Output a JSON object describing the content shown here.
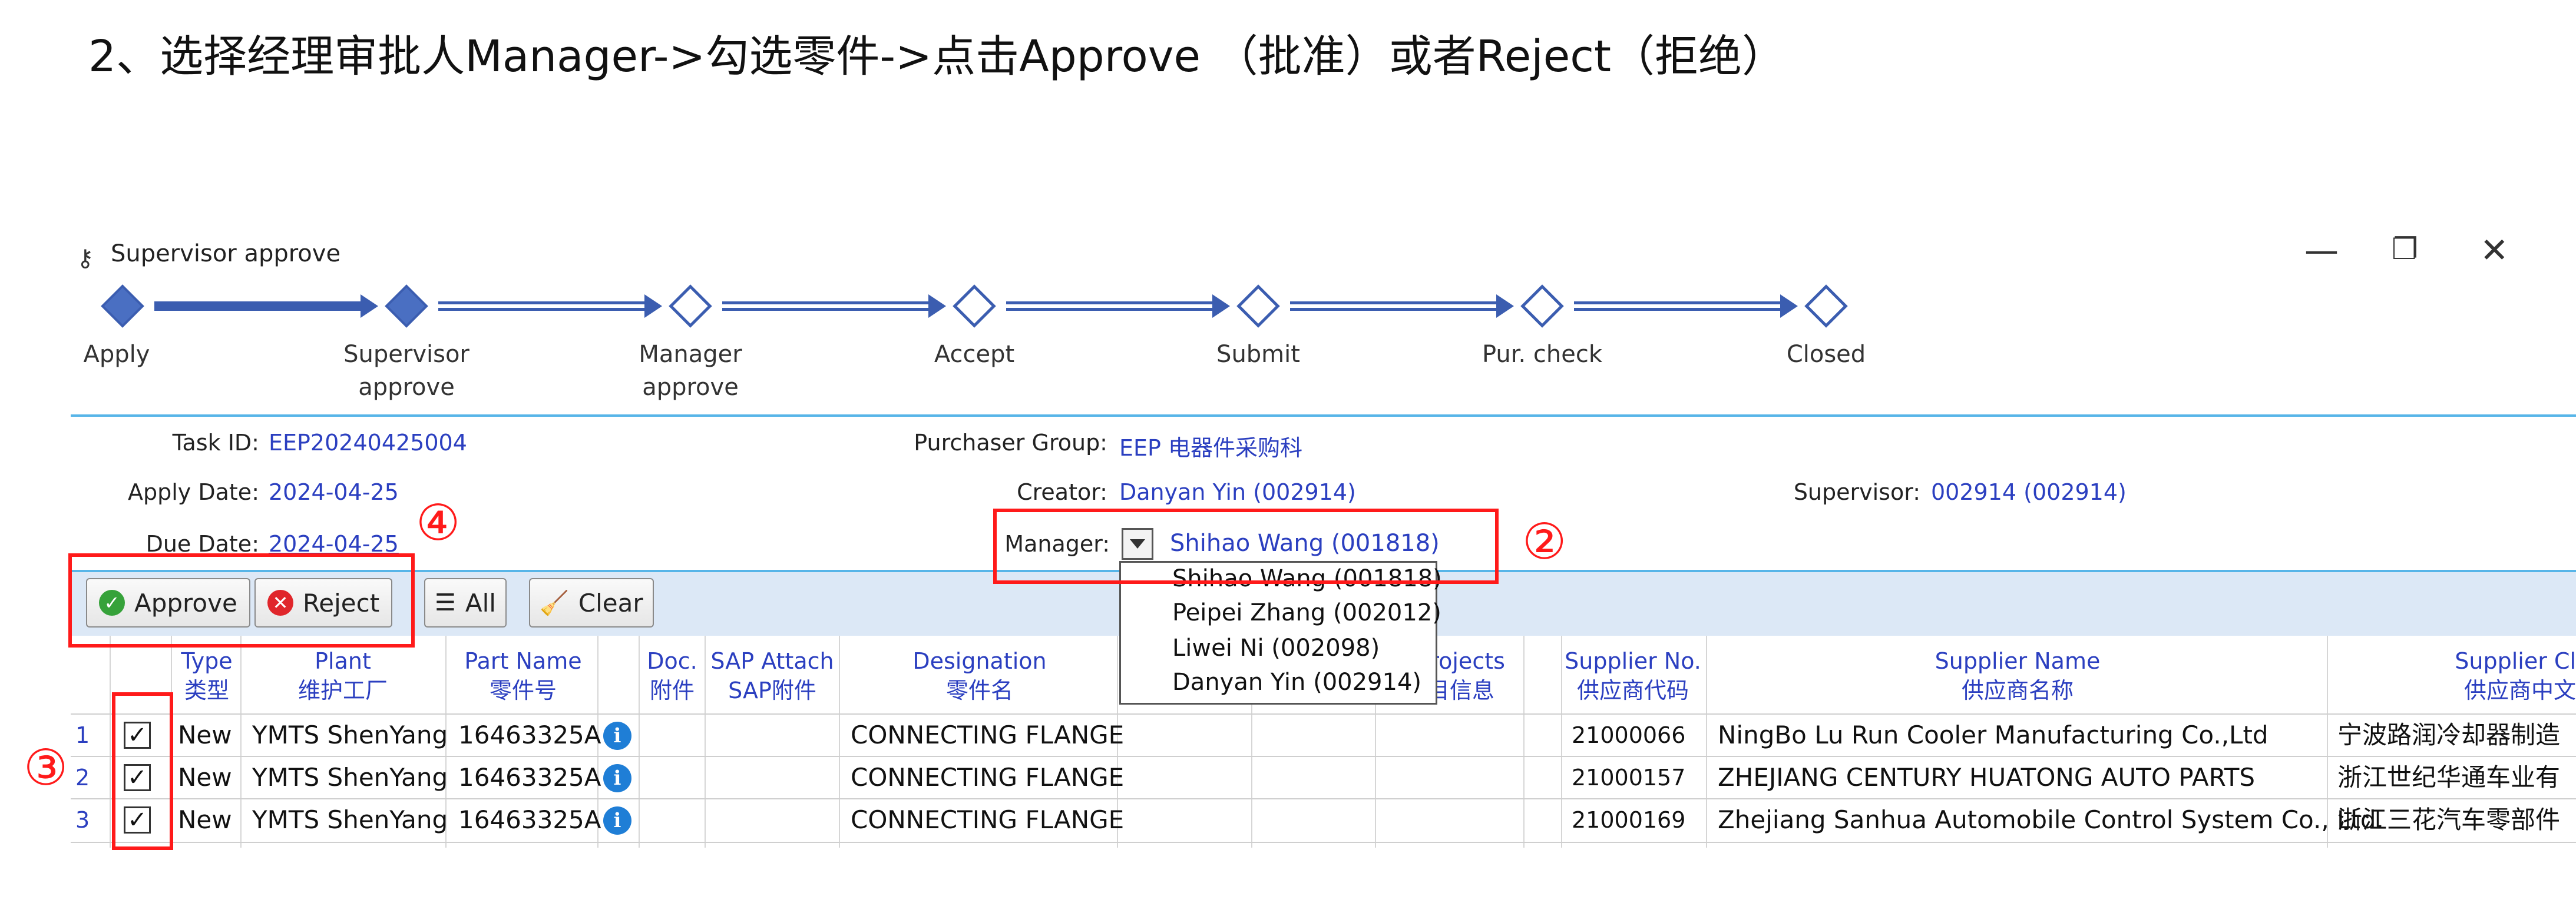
{
  "heading": "2、选择经理审批人Manager->勾选零件->点击Approve （批准）或者Reject（拒绝）",
  "window": {
    "title": "Supervisor approve",
    "controls": {
      "minimize": "—",
      "restore": "❐",
      "close": "✕"
    }
  },
  "workflow": {
    "steps": [
      {
        "label1": "Apply",
        "label2": "",
        "status": "done"
      },
      {
        "label1": "Supervisor",
        "label2": "approve",
        "status": "done"
      },
      {
        "label1": "Manager",
        "label2": "approve",
        "status": "todo"
      },
      {
        "label1": "Accept",
        "label2": "",
        "status": "todo"
      },
      {
        "label1": "Submit",
        "label2": "",
        "status": "todo"
      },
      {
        "label1": "Pur. check",
        "label2": "",
        "status": "todo"
      },
      {
        "label1": "Closed",
        "label2": "",
        "status": "todo"
      }
    ]
  },
  "info": {
    "task_id_label": "Task ID:",
    "task_id": "EEP20240425004",
    "purchaser_group_label": "Purchaser Group:",
    "purchaser_group": "EEP 电器件采购科",
    "apply_date_label": "Apply Date:",
    "apply_date": "2024-04-25",
    "creator_label": "Creator:",
    "creator": "Danyan Yin (002914)",
    "supervisor_label": "Supervisor:",
    "supervisor": "002914 (002914)",
    "due_date_label": "Due Date:",
    "due_date": "2024-04-25",
    "manager_label": "Manager:",
    "manager_selected": "Shihao Wang (001818)"
  },
  "manager_dropdown": {
    "options": [
      "Shihao Wang (001818)",
      "Peipei Zhang (002012)",
      "Liwei Ni (002098)",
      "Danyan Yin (002914)"
    ]
  },
  "toolbar": {
    "approve_label": "Approve",
    "reject_label": "Reject",
    "all_label": "All",
    "clear_label": "Clear"
  },
  "table": {
    "headers": {
      "type": [
        "Type",
        "类型"
      ],
      "plant": [
        "Plant",
        "维护工厂"
      ],
      "part_name": [
        "Part Name",
        "零件号"
      ],
      "doc": [
        "Doc.",
        "附件"
      ],
      "sap": [
        "SAP Attach",
        "SAP附件"
      ],
      "designation": [
        "Designation",
        "零件名"
      ],
      "projects": [
        "Projects",
        "目信息"
      ],
      "supplier_no": [
        "Supplier No.",
        "供应商代码"
      ],
      "supplier_name": [
        "Supplier Name",
        "供应商名称"
      ],
      "supplier_cn": [
        "Supplier Cl",
        "供应商中文"
      ]
    },
    "rows": [
      {
        "num": "1",
        "checked": true,
        "type": "New",
        "plant": "YMTS ShenYang",
        "part": "16463325A",
        "designation": "CONNECTING FLANGE",
        "supplier_no": "21000066",
        "supplier_name": "NingBo Lu Run Cooler Manufacturing Co.,Ltd",
        "supplier_cn": "宁波路润冷却器制造"
      },
      {
        "num": "2",
        "checked": true,
        "type": "New",
        "plant": "YMTS ShenYang",
        "part": "16463325A",
        "designation": "CONNECTING FLANGE",
        "supplier_no": "21000157",
        "supplier_name": "ZHEJIANG CENTURY HUATONG AUTO PARTS",
        "supplier_cn": "浙江世纪华通车业有"
      },
      {
        "num": "3",
        "checked": true,
        "type": "New",
        "plant": "YMTS ShenYang",
        "part": "16463325A",
        "designation": "CONNECTING FLANGE",
        "supplier_no": "21000169",
        "supplier_name": "Zhejiang Sanhua Automobile Control System Co., Ltd.",
        "supplier_cn": "浙江三花汽车零部件"
      }
    ]
  },
  "annotations": {
    "n2": "②",
    "n3": "③",
    "n4": "④"
  },
  "colors": {
    "accent": "#2b3fc0",
    "workflow": "#3b5db0",
    "separator": "#57b5e8",
    "annotation": "#ff1a1a",
    "toolbar_bg": "#dce8f6"
  }
}
